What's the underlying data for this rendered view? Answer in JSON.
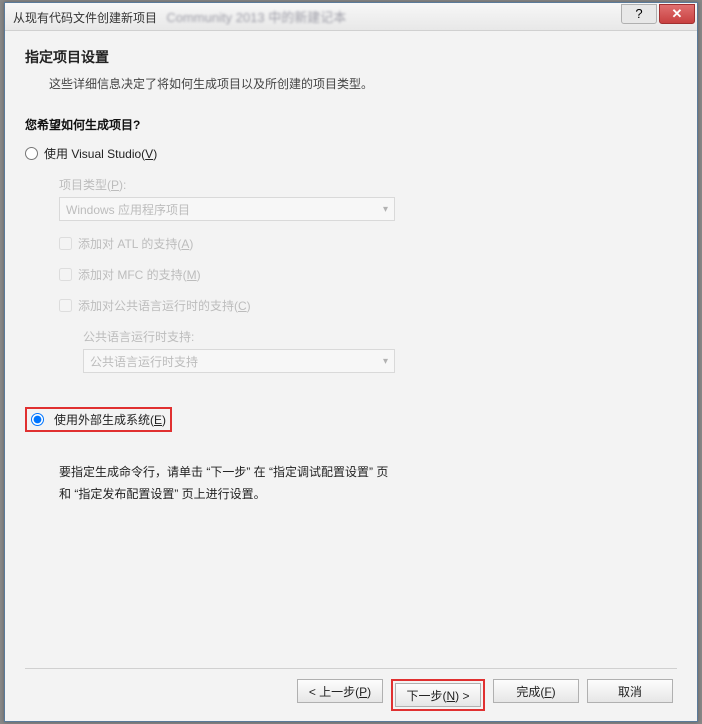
{
  "titlebar": {
    "text": "从现有代码文件创建新项目",
    "blur_extra": "Community 2013 中的新建记本"
  },
  "header": {
    "title": "指定项目设置",
    "subtitle": "这些详细信息决定了将如何生成项目以及所创建的项目类型。"
  },
  "question": "您希望如何生成项目?",
  "vs_option": {
    "label_pre": "使用 Visual Studio(",
    "label_key": "V",
    "label_post": ")",
    "ptype_label_pre": "项目类型(",
    "ptype_label_key": "P",
    "ptype_label_post": "):",
    "ptype_value": "Windows 应用程序项目",
    "atl_pre": "添加对 ATL 的支持(",
    "atl_key": "A",
    "atl_post": ")",
    "mfc_pre": "添加对 MFC 的支持(",
    "mfc_key": "M",
    "mfc_post": ")",
    "clr_pre": "添加对公共语言运行时的支持(",
    "clr_key": "C",
    "clr_post": ")",
    "clr_sub_label": "公共语言运行时支持:",
    "clr_sub_value": "公共语言运行时支持"
  },
  "ext_option": {
    "label_pre": "使用外部生成系统(",
    "label_key": "E",
    "label_post": ")",
    "desc": "要指定生成命令行，请单击 “下一步” 在 “指定调试配置设置” 页和 “指定发布配置设置” 页上进行设置。"
  },
  "buttons": {
    "prev_pre": "< 上一步(",
    "prev_key": "P",
    "prev_post": ")",
    "next_pre": "下一步(",
    "next_key": "N",
    "next_post": ") >",
    "finish_pre": "完成(",
    "finish_key": "F",
    "finish_post": ")",
    "cancel": "取消"
  }
}
